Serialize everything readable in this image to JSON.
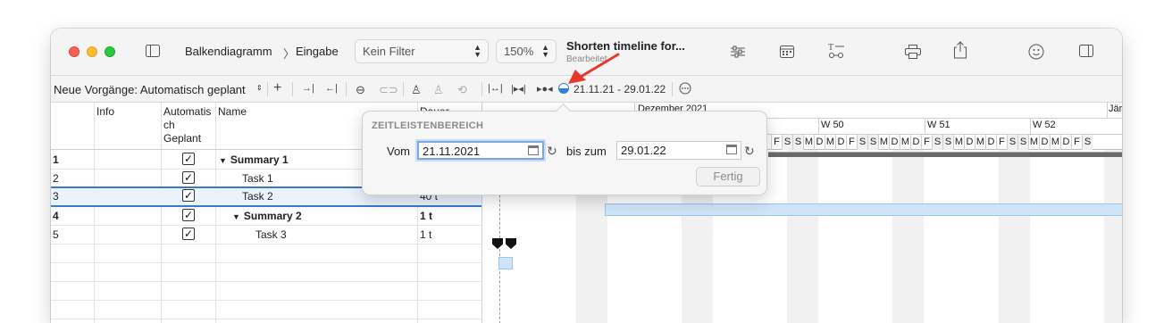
{
  "toolbar": {
    "breadcrumb_first": "Balkendiagramm",
    "breadcrumb_sep": "〉",
    "breadcrumb_second": "Eingabe",
    "filter_value": "Kein Filter",
    "zoom_value": "150%",
    "doc_title": "Shorten timeline for...",
    "doc_subtitle": "Bearbeitet"
  },
  "toolbar2": {
    "new_tasks_label": "Neue Vorgänge: Automatisch geplant",
    "date_range": "21.11.21 - 29.01.22"
  },
  "grid": {
    "headers": {
      "info": "Info",
      "auto": "Automatis\nch\nGeplant",
      "name": "Name",
      "duration": "Dauer"
    },
    "rows": [
      {
        "num": "1",
        "checked": "✓",
        "name": "Summary 1",
        "duration": "",
        "bold": true,
        "summary": true,
        "indent": 0
      },
      {
        "num": "2",
        "checked": "✓",
        "name": "Task 1",
        "duration": "",
        "bold": false,
        "summary": false,
        "indent": 1
      },
      {
        "num": "3",
        "checked": "✓",
        "name": "Task 2",
        "duration": "40 t",
        "bold": false,
        "summary": false,
        "indent": 1
      },
      {
        "num": "4",
        "checked": "✓",
        "name": "Summary 2",
        "duration": "1 t",
        "bold": true,
        "summary": true,
        "indent": 1
      },
      {
        "num": "5",
        "checked": "✓",
        "name": "Task 3",
        "duration": "1 t",
        "bold": false,
        "summary": false,
        "indent": 2
      }
    ]
  },
  "gantt": {
    "month_1": "Dezember 2021",
    "month_2": "Jär",
    "weeks": [
      "W 50",
      "W 51",
      "W 52"
    ],
    "days": [
      "F",
      "S",
      "S",
      "M",
      "D",
      "M",
      "D",
      "F",
      "S",
      "S",
      "M",
      "D",
      "M",
      "D",
      "F",
      "S",
      "S",
      "M",
      "D",
      "M",
      "D",
      "F",
      "S",
      "S",
      "M",
      "D",
      "M",
      "D",
      "F",
      "S"
    ]
  },
  "popover": {
    "title": "ZEITLEISTENBEREICH",
    "from_label": "Vom",
    "from_value": "21.11.2021",
    "to_label": "bis zum",
    "to_value": "29.01.22",
    "done_label": "Fertig"
  },
  "colors": {
    "selection_border": "#3a78c9",
    "task_bar": "#cfe4f8",
    "annotation_arrow": "#e8382c"
  }
}
